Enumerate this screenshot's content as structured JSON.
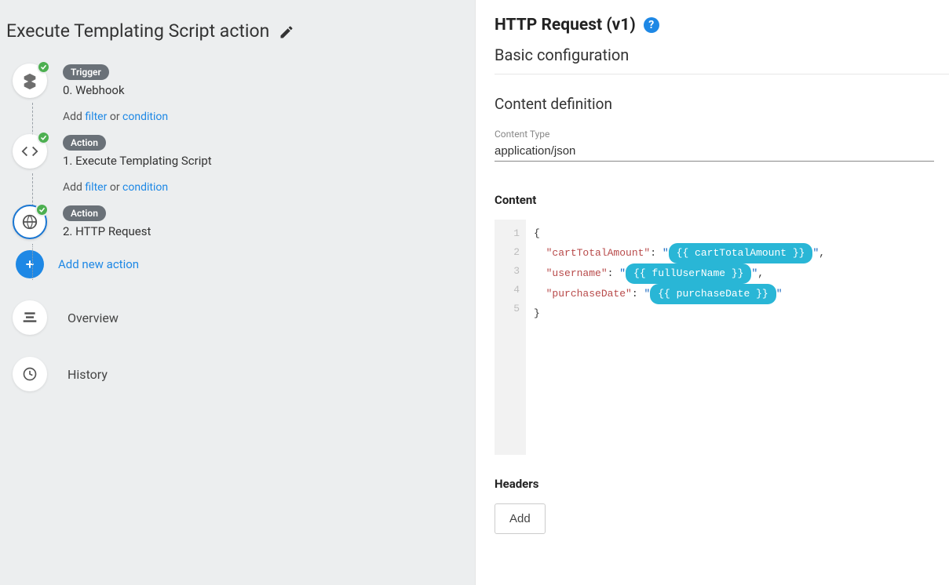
{
  "page": {
    "title": "Execute Templating Script action"
  },
  "steps": [
    {
      "pill": "Trigger",
      "index": "0.",
      "name": "Webhook",
      "icon": "cubes"
    },
    {
      "pill": "Action",
      "index": "1.",
      "name": "Execute Templating Script",
      "icon": "code"
    },
    {
      "pill": "Action",
      "index": "2.",
      "name": "HTTP Request",
      "icon": "globe",
      "selected": true
    }
  ],
  "filterLine": {
    "add": "Add",
    "filter": "filter",
    "or": "or",
    "condition": "condition"
  },
  "addNew": {
    "label": "Add new action"
  },
  "nav": {
    "overview": "Overview",
    "history": "History"
  },
  "right": {
    "title": "HTTP Request (v1)",
    "basic": "Basic configuration",
    "contentDef": "Content definition",
    "contentTypeLabel": "Content Type",
    "contentTypeValue": "application/json",
    "contentLabel": "Content",
    "lines": [
      "1",
      "2",
      "3",
      "4",
      "5"
    ],
    "code": {
      "k1": "\"cartTotalAmount\"",
      "v1": "{{ cartTotalAmount }}",
      "k2": "\"username\"",
      "v2": "{{ fullUserName }}",
      "k3": "\"purchaseDate\"",
      "v3": "{{ purchaseDate }}"
    },
    "headersLabel": "Headers",
    "addBtn": "Add"
  }
}
